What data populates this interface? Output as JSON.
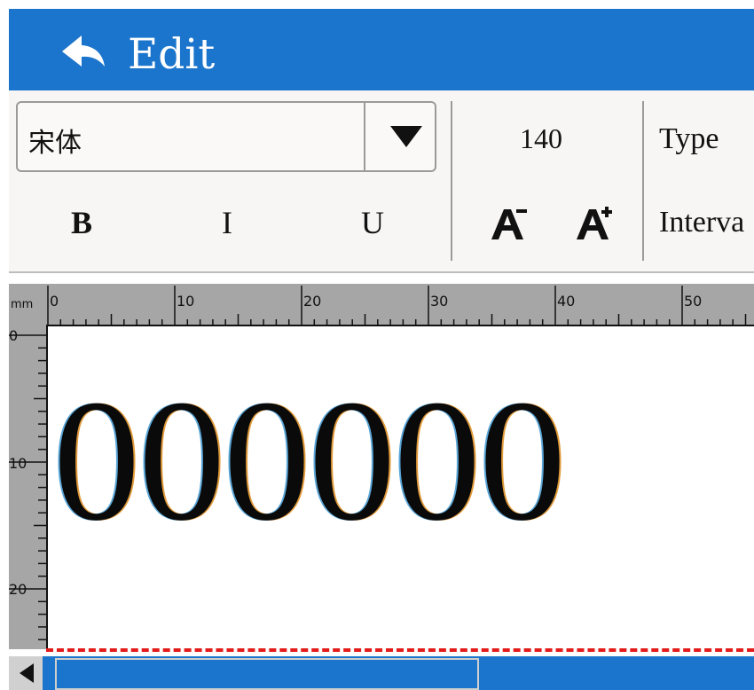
{
  "header": {
    "title": "Edit",
    "back_icon": "back-arrow-icon"
  },
  "toolbar": {
    "font_value": "宋体",
    "bold_label": "B",
    "italic_label": "I",
    "underline_label": "U",
    "font_size": "140",
    "shrink_icon": "font-size-decrease-icon",
    "grow_icon": "font-size-increase-icon",
    "type_label": "Type",
    "interval_label": "Interva"
  },
  "ruler": {
    "unit": "mm",
    "top_ticks": [
      "0",
      "10",
      "20",
      "30",
      "40",
      "50"
    ],
    "left_ticks": [
      "0",
      "10",
      "20"
    ]
  },
  "canvas": {
    "text": "000000"
  },
  "colors": {
    "accent": "#1c75cc",
    "boundary": "#e31b1b",
    "ruler": "#a6a6a6"
  }
}
